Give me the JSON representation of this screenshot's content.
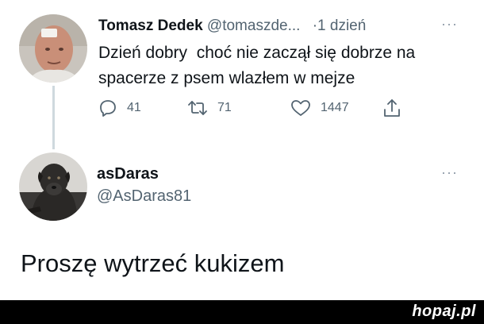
{
  "tweet": {
    "display_name": "Tomasz Dedek",
    "handle": "@tomaszde...",
    "separator": "·",
    "time": "1 dzień",
    "more": "···",
    "text": "Dzień dobry  choć nie zaczął się dobrze na\nspacerze z psem wlazłem w mejze",
    "actions": {
      "replies": "41",
      "retweets": "71",
      "likes": "1447"
    }
  },
  "reply": {
    "display_name": "asDaras",
    "handle": "@AsDaras81",
    "more": "···",
    "text": "Proszę wytrzeć kukizem"
  },
  "footer": {
    "watermark": "hopaj.pl"
  },
  "colors": {
    "primary_text": "#0f1419",
    "secondary_text": "#536471",
    "thread_line": "#cfd9de",
    "footer_bg": "#000000"
  },
  "icons": [
    "reply-icon",
    "retweet-icon",
    "like-icon",
    "share-icon",
    "more-icon"
  ]
}
